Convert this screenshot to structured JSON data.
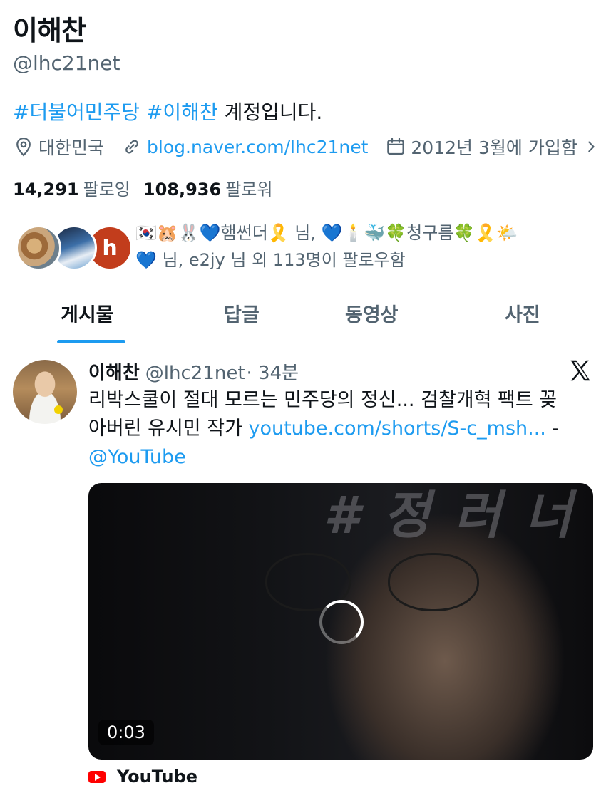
{
  "profile": {
    "display_name": "이해찬",
    "handle": "@lhc21net",
    "bio": {
      "hashtag1": "#더불어민주당",
      "hashtag2": "#이해찬",
      "text": " 계정입니다."
    },
    "location": "대한민국",
    "website": "blog.naver.com/lhc21net",
    "joined": "2012년 3월에 가입함",
    "following_count": "14,291",
    "following_label": "팔로잉",
    "followers_count": "108,936",
    "followers_label": "팔로워",
    "followed_by_line1": "🇰🇷🐹🐰💙햄썬더🎗️ 님, 💙🕯️🐳🍀청구름🍀🎗️🌤️",
    "followed_by_line2": "💙 님, e2jy 님 외 113명이 팔로우함",
    "avatar3_letter": "h"
  },
  "tabs": [
    {
      "label": "게시물"
    },
    {
      "label": "답글"
    },
    {
      "label": "동영상"
    },
    {
      "label": "사진"
    }
  ],
  "tweet": {
    "author": "이해찬",
    "handle": "@lhc21net",
    "time": "· 34분",
    "text_line1": "리박스쿨이 절대 모르는 민주당의 정신... 검찰개혁 팩트 꽂",
    "text_line2_plain": "아버린 유시민 작가 ",
    "link": "youtube.com/shorts/S-c_msh...",
    "dash": " -",
    "mention": "@YouTube",
    "video_duration": "0:03",
    "video_watermark": "# 정 러 너",
    "source_label": "YouTube"
  },
  "colors": {
    "accent": "#1d9bf0",
    "text": "#0f1419",
    "secondary": "#536471",
    "youtube": "#ff0000"
  },
  "icons": [
    "location-pin-icon",
    "link-icon",
    "calendar-icon",
    "chevron-right-icon",
    "x-logo-icon",
    "loading-spinner-icon",
    "youtube-icon"
  ]
}
